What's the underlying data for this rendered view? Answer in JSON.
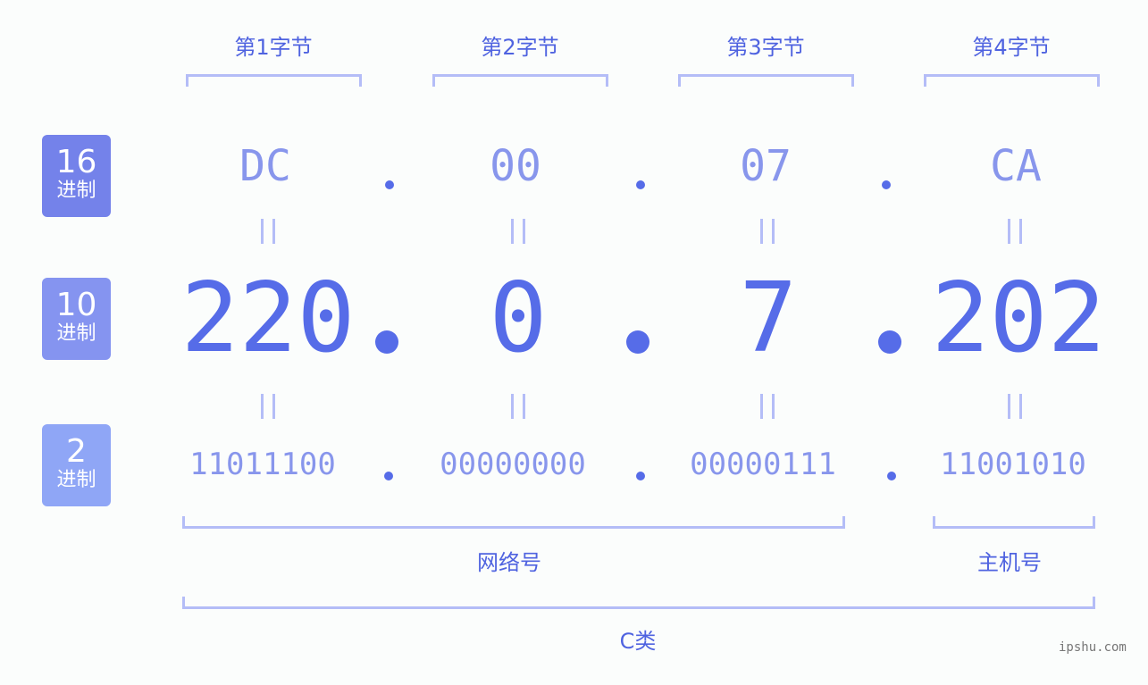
{
  "bytes": [
    {
      "title": "第1字节",
      "hex": "DC",
      "dec": "220",
      "bin": "11011100"
    },
    {
      "title": "第2字节",
      "hex": "00",
      "dec": "0",
      "bin": "00000000"
    },
    {
      "title": "第3字节",
      "hex": "07",
      "dec": "7",
      "bin": "00000111"
    },
    {
      "title": "第4字节",
      "hex": "CA",
      "dec": "202",
      "bin": "11001010"
    }
  ],
  "badges": [
    {
      "num": "16",
      "label": "进制",
      "color": "#7482ea"
    },
    {
      "num": "10",
      "label": "进制",
      "color": "#8594f0"
    },
    {
      "num": "2",
      "label": "进制",
      "color": "#8fa6f6"
    }
  ],
  "separator": ".",
  "equals": "=",
  "network_label": "网络号",
  "host_label": "主机号",
  "class_label": "C类",
  "watermark": "ipshu.com",
  "colors": {
    "accent": "#566ce8",
    "light": "#8896ec",
    "bracket": "#b4bdf7"
  }
}
